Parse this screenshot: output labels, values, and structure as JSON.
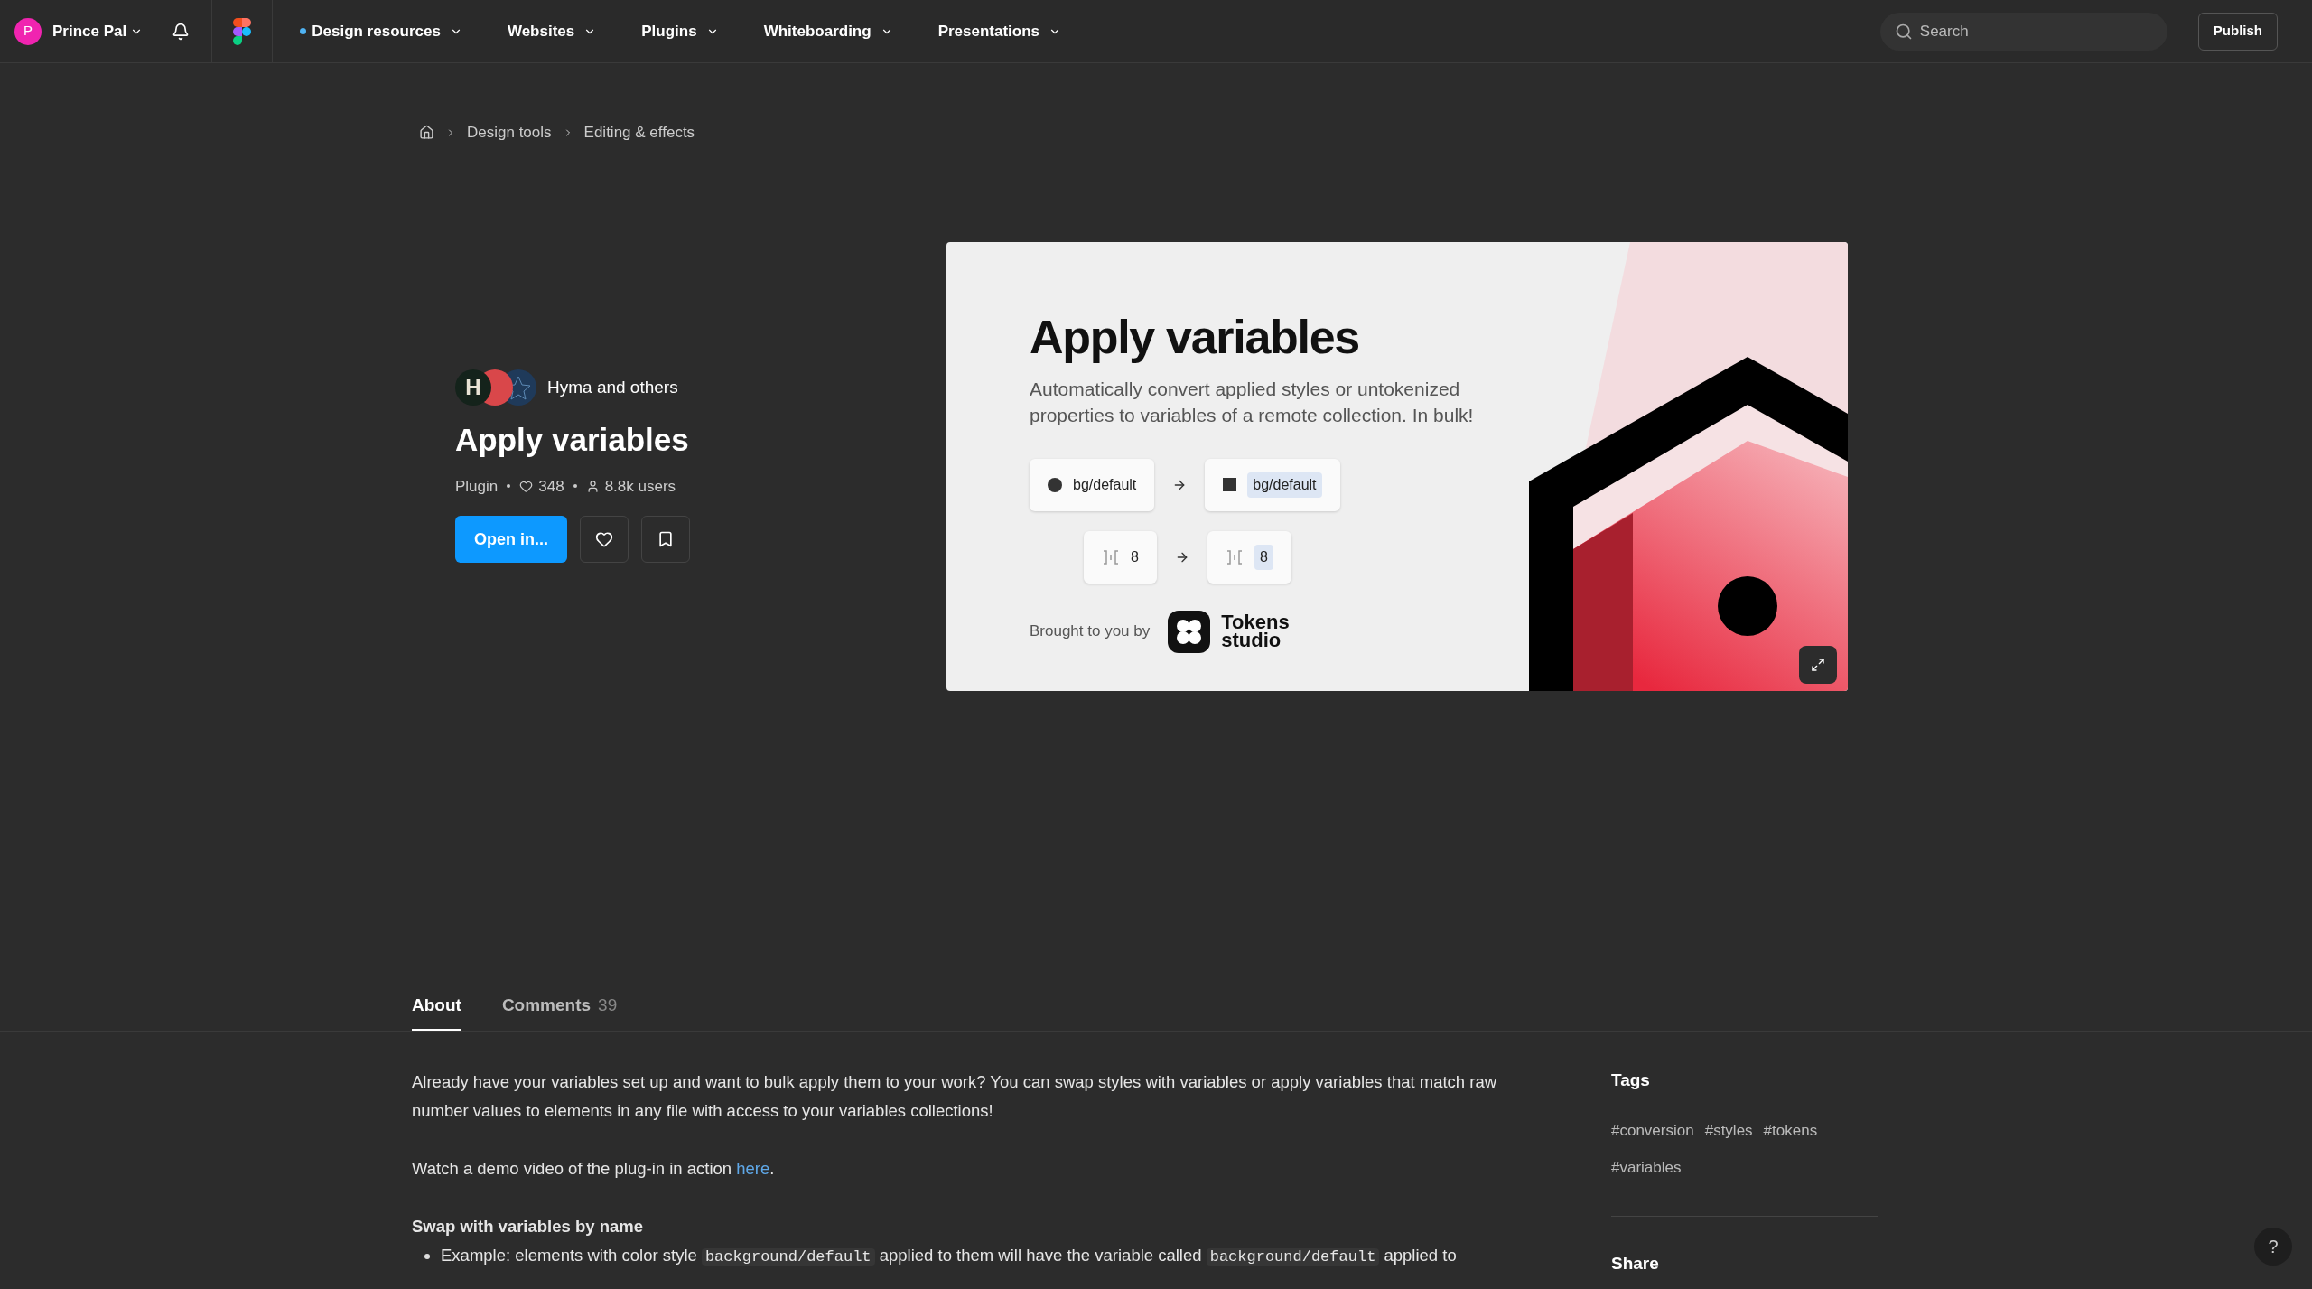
{
  "top_bar": {
    "user": {
      "initial": "P",
      "name": "Prince Pal"
    },
    "nav": [
      {
        "label": "Design resources",
        "dot": true
      },
      {
        "label": "Websites",
        "dot": false
      },
      {
        "label": "Plugins",
        "dot": false
      },
      {
        "label": "Whiteboarding",
        "dot": false
      },
      {
        "label": "Presentations",
        "dot": false
      }
    ],
    "search": {
      "placeholder": "Search"
    },
    "publish": "Publish"
  },
  "breadcrumb": [
    "Design tools",
    "Editing & effects"
  ],
  "plugin": {
    "avatar_letter": "H",
    "authors": "Hyma and others",
    "title": "Apply variables",
    "type": "Plugin",
    "likes": "348",
    "users": "8.8k users",
    "open_button": "Open in..."
  },
  "banner": {
    "title": "Apply variables",
    "subtitle": "Automatically convert applied styles or untokenized properties to variables of a remote collection. In bulk!",
    "rows": [
      {
        "kind": "color",
        "from": "bg/default",
        "to": "bg/default"
      },
      {
        "kind": "spacing",
        "from": "8",
        "to": "8"
      }
    ],
    "credit": "Brought to you by",
    "logo_top": "Tokens",
    "logo_bottom": "studio"
  },
  "tabs": [
    {
      "label": "About",
      "selected": true
    },
    {
      "label": "Comments",
      "count": "39",
      "selected": false
    }
  ],
  "about": {
    "intro": "Already have your variables set up and want to bulk apply them to your work? You can swap styles with variables or apply variables that match raw number values to elements in any file with access to your variables collections!",
    "demo": {
      "text": "Watch a demo video of the plug-in in action ",
      "link": "here",
      "after": "."
    },
    "sections": [
      {
        "heading": "Swap with variables by name",
        "bullets": [
          {
            "parts": [
              {
                "kind": "text",
                "text": "Example: elements with color style "
              },
              {
                "kind": "code",
                "text": "background/default"
              },
              {
                "kind": "text",
                "text": " applied to them will have the variable called "
              },
              {
                "kind": "code",
                "text": "background/default"
              },
              {
                "kind": "text",
                "text": " applied to"
              }
            ]
          }
        ]
      }
    ]
  },
  "tags": {
    "title": "Tags",
    "items": [
      "#conversion",
      "#styles",
      "#tokens",
      "#variables"
    ]
  },
  "share": "Share",
  "help": "?"
}
